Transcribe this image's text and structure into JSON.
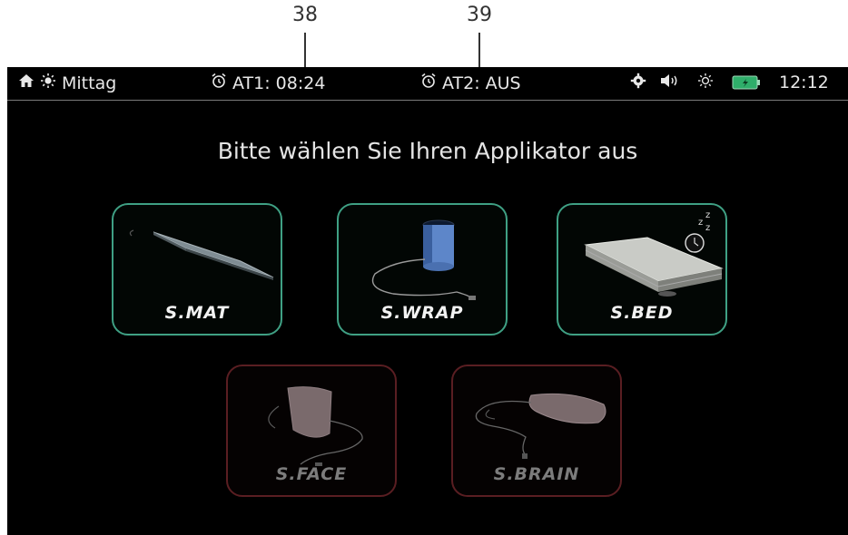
{
  "callouts": [
    "38",
    "39"
  ],
  "statusbar": {
    "mode_label": "Mittag",
    "alarm1": "AT1: 08:24",
    "alarm2": "AT2: AUS",
    "time": "12:12",
    "icons": [
      "home-icon",
      "sun-icon",
      "alarm-clock-icon",
      "gear-icon",
      "speaker-icon",
      "brightness-icon",
      "battery-icon"
    ],
    "battery_color": "#2fae6a"
  },
  "main": {
    "title": "Bitte wählen Sie Ihren Applikator aus",
    "applicators": [
      {
        "label": "S.MAT",
        "enabled": true
      },
      {
        "label": "S.WRAP",
        "enabled": true
      },
      {
        "label": "S.BED",
        "enabled": true
      },
      {
        "label": "S.FACE",
        "enabled": false
      },
      {
        "label": "S.BRAIN",
        "enabled": false
      }
    ]
  },
  "colors": {
    "active_border": "#3fa084",
    "inactive_border": "#5a1e22"
  }
}
